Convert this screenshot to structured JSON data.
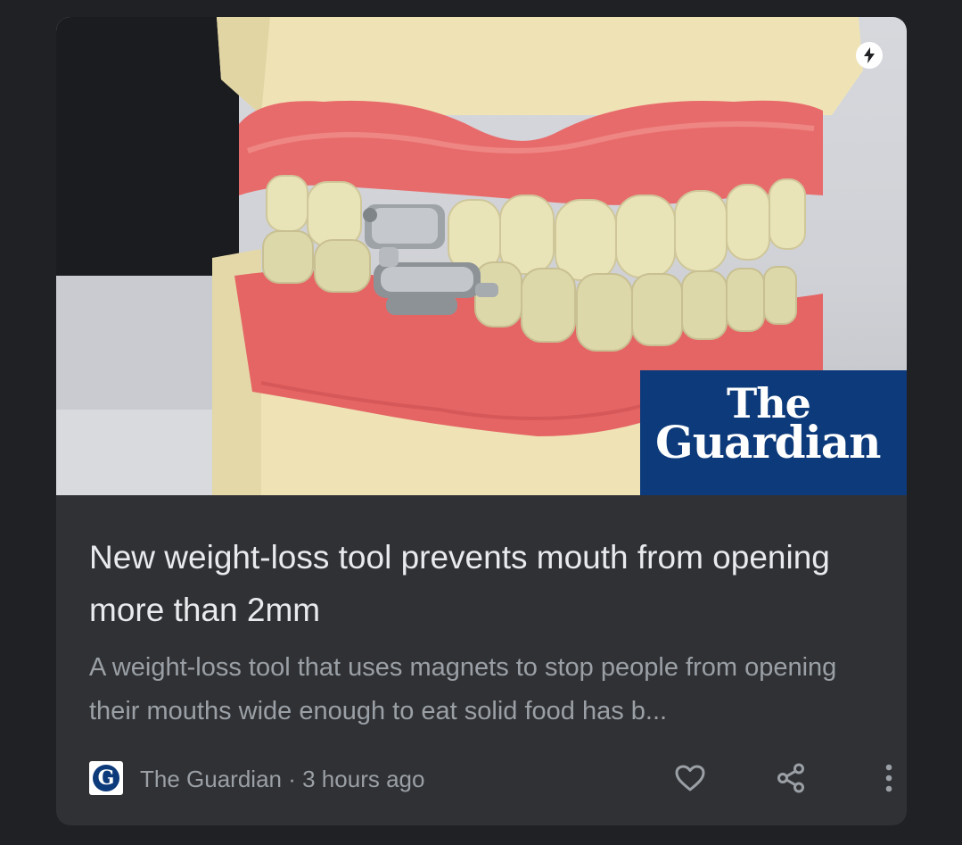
{
  "card": {
    "headline": "New weight-loss tool prevents mouth from opening more than 2mm",
    "snippet": "A weight-loss tool that uses magnets to stop people from opening their mouths wide enough to eat solid food has b...",
    "source": {
      "name": "The Guardian",
      "separator": "·",
      "time": "3 hours ago",
      "logo_letter": "G"
    },
    "image": {
      "brand_line1": "The",
      "brand_line2": "Guardian",
      "amp_icon": "lightning-icon"
    },
    "actions": [
      {
        "icon": "heart-outline-icon"
      },
      {
        "icon": "share-icon"
      },
      {
        "icon": "more-vert-icon"
      }
    ]
  },
  "colors": {
    "background": "#202124",
    "card": "#303134",
    "headline": "#e8eaed",
    "secondary": "#9aa0a6",
    "brand_blue": "#0d3a7a"
  }
}
